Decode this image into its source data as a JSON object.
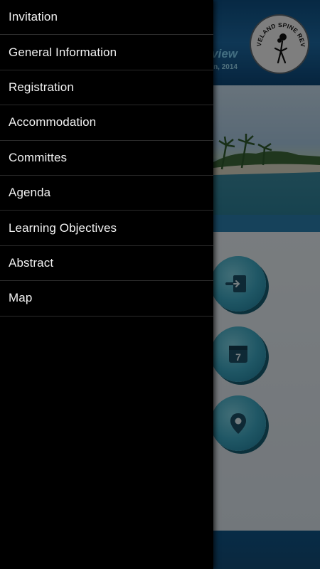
{
  "header": {
    "title_fragment": "view",
    "date_fragment": "n, 2014",
    "logo": {
      "text": "CLEVELAND SPINE REVIEW",
      "icon": "spine-figure-logo-icon"
    }
  },
  "banner": {
    "image": "beach-palm-trees-photo"
  },
  "content": {
    "buttons": [
      {
        "icon": "login-arrow-icon"
      },
      {
        "icon": "calendar-icon",
        "label": "7"
      },
      {
        "icon": "map-pin-icon"
      }
    ]
  },
  "drawer": {
    "items": [
      {
        "label": "Invitation"
      },
      {
        "label": "General Information"
      },
      {
        "label": "Registration"
      },
      {
        "label": "Accommodation"
      },
      {
        "label": "Committes"
      },
      {
        "label": "Agenda"
      },
      {
        "label": "Learning Objectives"
      },
      {
        "label": "Abstract"
      },
      {
        "label": "Map"
      }
    ]
  },
  "colors": {
    "drawer_bg": "#000000",
    "drawer_text": "#f1f1f1",
    "divider": "#2b2b2b",
    "header_blue": "#1d6aa3",
    "button_teal": "#3ea8c3"
  }
}
